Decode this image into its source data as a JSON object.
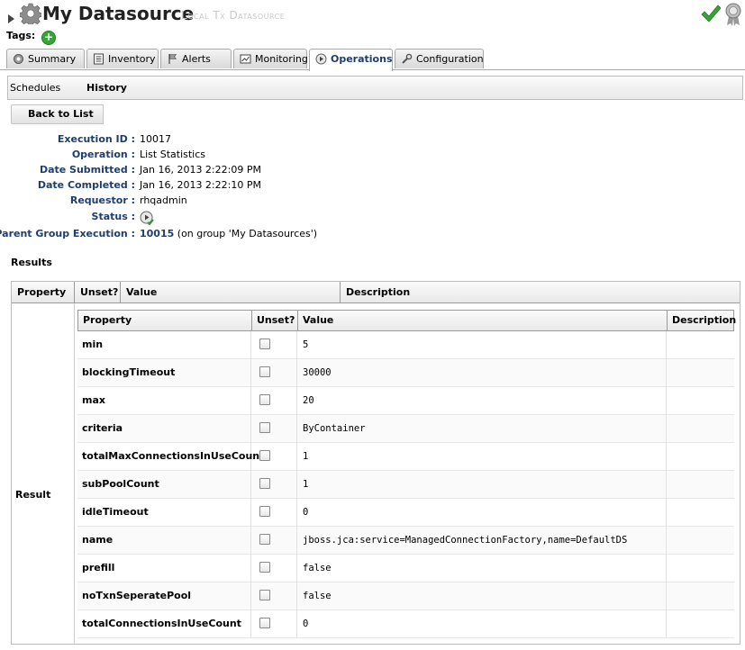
{
  "header": {
    "title": "My Datasource",
    "subtitle": "Local Tx Datasource",
    "tags_label": "Tags:",
    "add_tag_symbol": "+"
  },
  "tabs": [
    {
      "label": "Summary",
      "icon": "gear-icon",
      "active": false
    },
    {
      "label": "Inventory",
      "icon": "inventory-icon",
      "active": false
    },
    {
      "label": "Alerts",
      "icon": "flag-icon",
      "active": false
    },
    {
      "label": "Monitoring",
      "icon": "monitor-icon",
      "active": false
    },
    {
      "label": "Operations",
      "icon": "play-icon",
      "active": true
    },
    {
      "label": "Configuration",
      "icon": "wrench-icon",
      "active": false
    }
  ],
  "subtabs": [
    {
      "label": "Schedules",
      "active": false
    },
    {
      "label": "History",
      "active": true
    }
  ],
  "back_button": "Back to List",
  "details": {
    "execution_id": {
      "label": "Execution ID :",
      "value": "10017"
    },
    "operation": {
      "label": "Operation :",
      "value": "List Statistics"
    },
    "date_submitted": {
      "label": "Date Submitted :",
      "value": "Jan 16, 2013 2:22:09 PM"
    },
    "date_completed": {
      "label": "Date Completed :",
      "value": "Jan 16, 2013 2:22:10 PM"
    },
    "requestor": {
      "label": "Requestor :",
      "value": "rhqadmin"
    },
    "status": {
      "label": "Status :",
      "icon": "status-success-icon"
    },
    "parent_group": {
      "label": "Parent Group Execution :",
      "link": "10015",
      "suffix": " (on group 'My Datasources')"
    }
  },
  "results": {
    "heading": "Results",
    "outer_headers": [
      "Property",
      "Unset?",
      "Value",
      "Description"
    ],
    "result_label": "Result",
    "inner_headers": [
      "Property",
      "Unset?",
      "Value",
      "Description"
    ],
    "rows": [
      {
        "property": "min",
        "value": "5"
      },
      {
        "property": "blockingTimeout",
        "value": "30000"
      },
      {
        "property": "max",
        "value": "20"
      },
      {
        "property": "criteria",
        "value": "ByContainer"
      },
      {
        "property": "totalMaxConnectionsInUseCount",
        "value": "1"
      },
      {
        "property": "subPoolCount",
        "value": "1"
      },
      {
        "property": "idleTimeout",
        "value": "0"
      },
      {
        "property": "name",
        "value": "jboss.jca:service=ManagedConnectionFactory,name=DefaultDS"
      },
      {
        "property": "prefill",
        "value": "false"
      },
      {
        "property": "noTxnSeperatePool",
        "value": "false"
      },
      {
        "property": "totalConnectionsInUseCount",
        "value": "0"
      }
    ]
  },
  "colors": {
    "label_blue": "#1f3d6e",
    "check_green": "#3aa23a"
  }
}
